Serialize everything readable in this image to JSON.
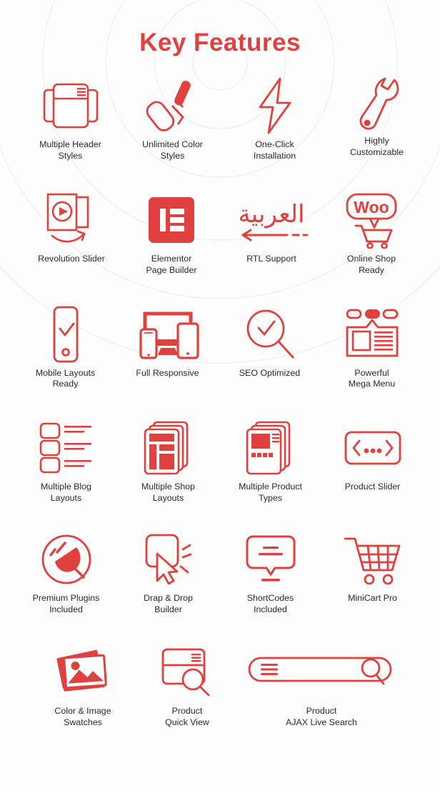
{
  "theme": {
    "accent": "#e0413e",
    "accent_soft": "#f2f2f2",
    "text": "#2b2b2b",
    "background": "#fdfdfd"
  },
  "header": {
    "title": "Key Features"
  },
  "features": {
    "rows": [
      {
        "items": [
          {
            "icon": "multiple-header-styles-icon",
            "label": "Multiple Header\nStyles"
          },
          {
            "icon": "paint-roller-icon",
            "label": "Unlimited Color\nStyles"
          },
          {
            "icon": "lightning-bolt-icon",
            "label": "One-Click\nInstallation"
          },
          {
            "icon": "wrench-icon",
            "label": "Highly\nCustomizable"
          }
        ]
      },
      {
        "items": [
          {
            "icon": "revolution-slider-icon",
            "label": "Revolution Slider"
          },
          {
            "icon": "elementor-icon",
            "label": "Elementor\nPage Builder"
          },
          {
            "icon": "rtl-arabic-icon",
            "label": "RTL Support",
            "glyph": "العربية"
          },
          {
            "icon": "woocommerce-icon",
            "label": "Online Shop\nReady",
            "glyph": "Woo"
          }
        ]
      },
      {
        "items": [
          {
            "icon": "mobile-phone-check-icon",
            "label": "Mobile Layouts\nReady"
          },
          {
            "icon": "responsive-devices-icon",
            "label": "Full Responsive"
          },
          {
            "icon": "seo-magnifier-check-icon",
            "label": "SEO Optimized"
          },
          {
            "icon": "mega-menu-icon",
            "label": "Powerful\nMega Menu"
          }
        ]
      },
      {
        "items": [
          {
            "icon": "blog-list-layout-icon",
            "label": "Multiple Blog\nLayouts"
          },
          {
            "icon": "shop-layout-pages-icon",
            "label": "Multiple Shop\nLayouts"
          },
          {
            "icon": "product-types-icon",
            "label": "Multiple Product\nTypes"
          },
          {
            "icon": "product-slider-icon",
            "label": "Product Slider"
          }
        ]
      },
      {
        "items": [
          {
            "icon": "plug-circle-icon",
            "label": "Premium Plugins\nIncluded"
          },
          {
            "icon": "drag-drop-cursor-icon",
            "label": "Drap & Drop\nBuilder"
          },
          {
            "icon": "shortcodes-bubble-icon",
            "label": "ShortCodes\nIncluded"
          },
          {
            "icon": "shopping-cart-icon",
            "label": "MiniCart Pro"
          }
        ]
      },
      {
        "items": [
          {
            "icon": "image-swatches-icon",
            "label": "Color & Image\nSwatches"
          },
          {
            "icon": "quick-view-icon",
            "label": "Product\nQuick View"
          },
          {
            "icon": "ajax-search-bar-icon",
            "label": "Product\nAJAX Live Search"
          }
        ]
      }
    ]
  }
}
